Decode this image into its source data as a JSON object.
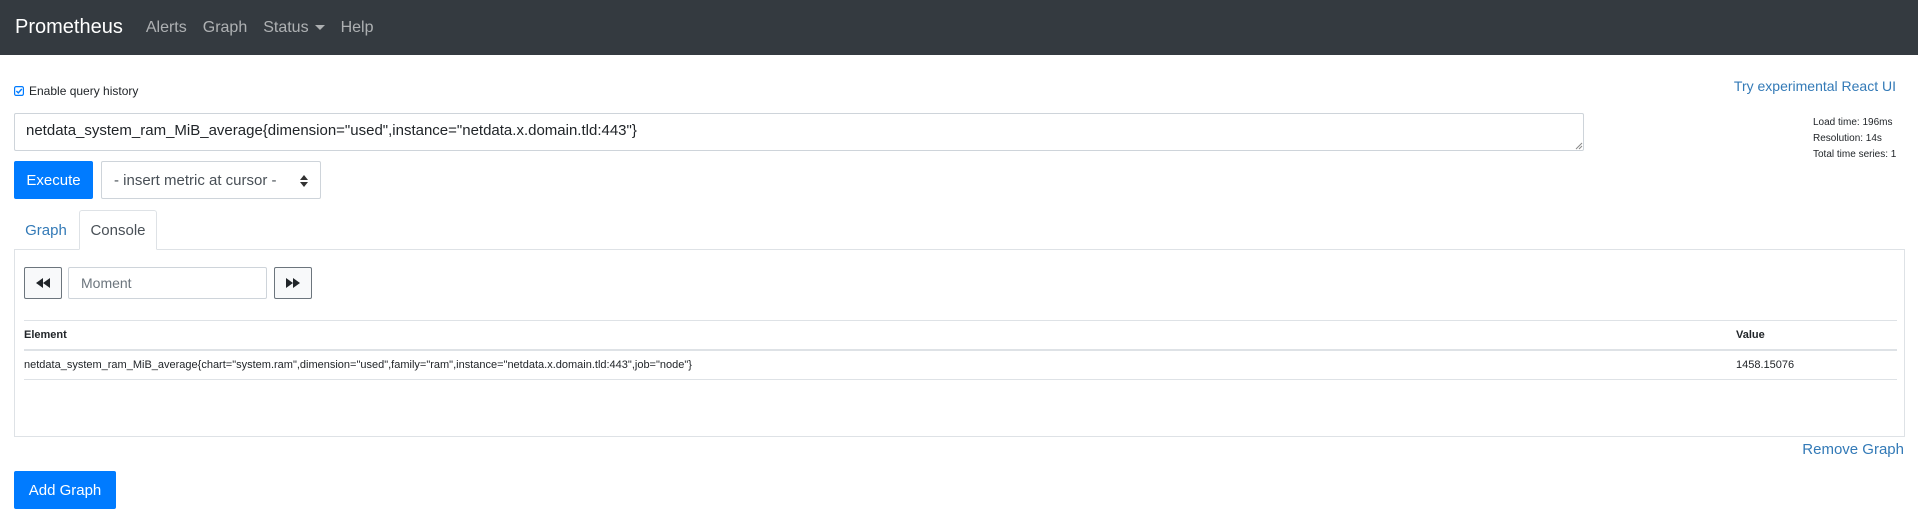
{
  "navbar": {
    "brand": "Prometheus",
    "links": [
      "Alerts",
      "Graph",
      "Status",
      "Help"
    ]
  },
  "query_history": {
    "label": "Enable query history",
    "checked": true
  },
  "react_ui_link": "Try experimental React UI",
  "query": {
    "value": "netdata_system_ram_MiB_average{dimension=\"used\",instance=\"netdata.x.domain.tld:443\"}"
  },
  "stats": {
    "load_time": "Load time: 196ms",
    "resolution": "Resolution: 14s",
    "total_series": "Total time series: 1"
  },
  "execute_label": "Execute",
  "metric_select": {
    "selected": "- insert metric at cursor -"
  },
  "tabs": {
    "graph": "Graph",
    "console": "Console",
    "active": "Console"
  },
  "console": {
    "moment_placeholder": "Moment",
    "table": {
      "headers": {
        "element": "Element",
        "value": "Value"
      },
      "rows": [
        {
          "element": "netdata_system_ram_MiB_average{chart=\"system.ram\",dimension=\"used\",family=\"ram\",instance=\"netdata.x.domain.tld:443\",job=\"node\"}",
          "value": "1458.15076"
        }
      ]
    }
  },
  "remove_graph": "Remove Graph",
  "add_graph": "Add Graph",
  "colors": {
    "navbar_bg": "#343a40",
    "primary": "#007bff",
    "link": "#337ab7"
  },
  "icons": {
    "history_checkbox": "check-square-icon",
    "select_arrows": "updown-icon",
    "back": "backward-icon",
    "forward": "forward-icon",
    "status_dropdown": "caret-down-icon"
  }
}
